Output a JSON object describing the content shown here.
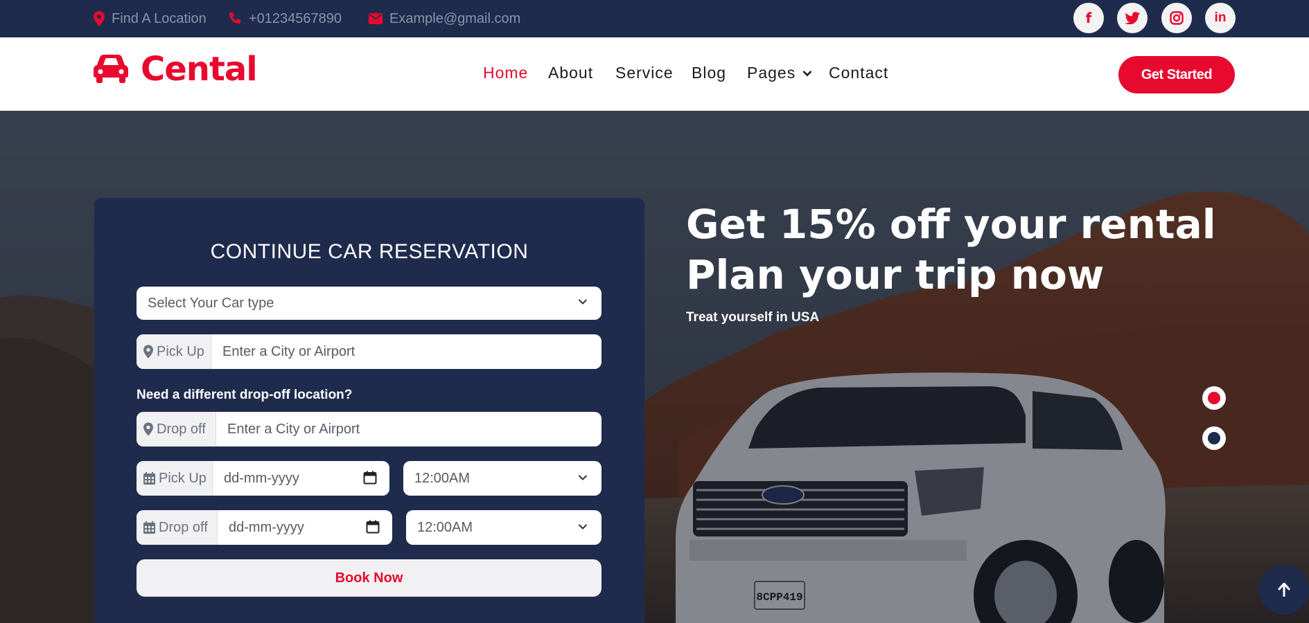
{
  "topbar": {
    "location": "Find A Location",
    "phone": "+01234567890",
    "email": "Example@gmail.com",
    "social": [
      {
        "icon": "facebook-icon",
        "glyph": "f"
      },
      {
        "icon": "twitter-icon",
        "glyph": ""
      },
      {
        "icon": "instagram-icon",
        "glyph": ""
      },
      {
        "icon": "linkedin-icon",
        "glyph": "in"
      }
    ]
  },
  "navbar": {
    "logo": "Cental",
    "links": [
      "Home",
      "About",
      "Service",
      "Blog",
      "Pages",
      "Contact"
    ],
    "active": "Home",
    "cta": "Get Started"
  },
  "form": {
    "title": "CONTINUE CAR RESERVATION",
    "car_type_placeholder": "Select Your Car type",
    "pickup_label": "Pick Up",
    "pickup_placeholder": "Enter a City or Airport",
    "dropoff_question": "Need a different drop-off location?",
    "dropoff_label": "Drop off",
    "dropoff_placeholder": "Enter a City or Airport",
    "pickup_date_label": "Pick Up",
    "pickup_date_placeholder": "dd-mm-yyyy",
    "pickup_time": "12:00AM",
    "dropoff_date_label": "Drop off",
    "dropoff_date_placeholder": "dd-mm-yyyy",
    "dropoff_time": "12:00AM",
    "submit": "Book Now"
  },
  "hero": {
    "headline_line1": "Get 15% off your rental",
    "headline_line2": "Plan your trip now",
    "subline": "Treat yourself in USA",
    "car_plate": "8CPP419"
  },
  "colors": {
    "accent": "#e8092e",
    "navy": "#1f2b4d"
  }
}
